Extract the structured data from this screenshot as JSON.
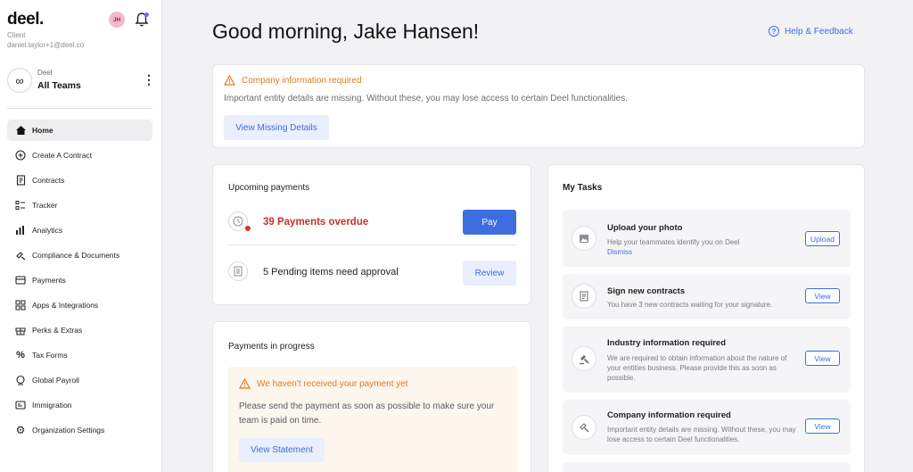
{
  "sidebar": {
    "logo": "deel.",
    "role": "Client",
    "email": "daniel.taylor+1@deel.co",
    "avatar_initials": "JH",
    "team": {
      "org": "Deel",
      "name": "All Teams"
    },
    "nav": [
      {
        "label": "Home",
        "icon": "home-icon",
        "active": true
      },
      {
        "label": "Create A Contract",
        "icon": "plus-circle-icon"
      },
      {
        "label": "Contracts",
        "icon": "contract-icon"
      },
      {
        "label": "Tracker",
        "icon": "tracker-icon"
      },
      {
        "label": "Analytics",
        "icon": "analytics-icon"
      },
      {
        "label": "Compliance & Documents",
        "icon": "compliance-icon"
      },
      {
        "label": "Payments",
        "icon": "card-icon"
      },
      {
        "label": "Apps & Integrations",
        "icon": "apps-icon"
      },
      {
        "label": "Perks & Extras",
        "icon": "gift-icon"
      },
      {
        "label": "Tax Forms",
        "icon": "percent-icon"
      },
      {
        "label": "Global Payroll",
        "icon": "globe-icon"
      },
      {
        "label": "Immigration",
        "icon": "id-card-icon"
      },
      {
        "label": "Organization Settings",
        "icon": "gear-icon"
      }
    ]
  },
  "header": {
    "greeting": "Good morning, Jake Hansen!",
    "help": "Help & Feedback"
  },
  "company_alert": {
    "title": "Company information required",
    "text": "Important entity details are missing. Without these, you may lose access to certain Deel functionalities.",
    "button": "View Missing Details"
  },
  "upcoming_payments": {
    "title": "Upcoming payments",
    "overdue": "39 Payments overdue",
    "pay_button": "Pay",
    "pending": "5 Pending items need approval",
    "review_button": "Review"
  },
  "payments_in_progress": {
    "title": "Payments in progress",
    "warning_title": "We haven't received your payment yet",
    "warning_text": "Please send the payment as soon as possible to make sure your team is paid on time.",
    "button": "View Statement"
  },
  "tasks": {
    "title": "My Tasks",
    "items": [
      {
        "title": "Upload your photo",
        "desc": "Help your teammates identify you on Deel",
        "link": "Dismiss",
        "button": "Upload",
        "icon": "image-icon"
      },
      {
        "title": "Sign new contracts",
        "desc": "You have 3 new contracts waiting for your signature.",
        "button": "View",
        "icon": "contract-icon"
      },
      {
        "title": "Industry information required",
        "desc": "We are required to obtain information about the nature of your entities business. Please provide this as soon as possible.",
        "button": "View",
        "icon": "gavel-icon"
      },
      {
        "title": "Company information required",
        "desc": "Important entity details are missing. Without these, you may lose access to certain Deel functionalities.",
        "button": "View",
        "icon": "gavel-icon"
      }
    ]
  },
  "colors": {
    "accent": "#3d6ee0",
    "warning": "#e07a1f",
    "danger": "#c9302c",
    "notification_dot": "#8b5cf6"
  }
}
